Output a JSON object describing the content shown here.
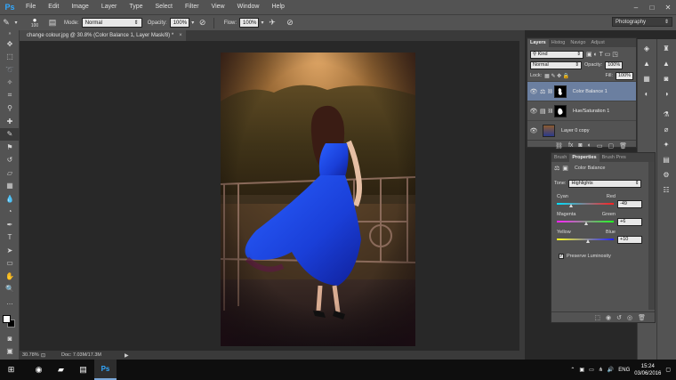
{
  "app": {
    "logo": "Ps"
  },
  "menu": [
    "File",
    "Edit",
    "Image",
    "Layer",
    "Type",
    "Select",
    "Filter",
    "View",
    "Window",
    "Help"
  ],
  "window_controls": {
    "minimize": "–",
    "maximize": "□",
    "close": "✕"
  },
  "options_bar": {
    "brush_size": "100",
    "mode_label": "Mode:",
    "mode_value": "Normal",
    "opacity_label": "Opacity:",
    "opacity_value": "100%",
    "flow_label": "Flow:",
    "flow_value": "100%"
  },
  "workspace": "Photography",
  "document": {
    "tab_title": "change colour.jpg @ 30.8% (Color Balance 1, Layer Mask/8) *",
    "tab_close": "×"
  },
  "status": {
    "zoom": "30.78%",
    "doc_info": "Doc: 7.03M/17.3M"
  },
  "layers_panel": {
    "tabs": [
      "Layers",
      "Histog",
      "Navigo",
      "Adjust"
    ],
    "kind_label": "Kind",
    "blend_mode": "Normal",
    "opacity_label": "Opacity:",
    "opacity_value": "100%",
    "lock_label": "Lock:",
    "fill_label": "Fill:",
    "fill_value": "100%",
    "layers": [
      {
        "name": "Color Balance 1"
      },
      {
        "name": "Hue/Saturation 1"
      },
      {
        "name": "Layer 0 copy"
      }
    ]
  },
  "properties_panel": {
    "tabs": [
      "Brush",
      "Properties",
      "Brush Pres"
    ],
    "title": "Color Balance",
    "tone_label": "Tone:",
    "tone_value": "Highlights",
    "sliders": [
      {
        "left": "Cyan",
        "right": "Red",
        "value": "-49",
        "fraction": 0.255
      },
      {
        "left": "Magenta",
        "right": "Green",
        "value": "+6",
        "fraction": 0.53
      },
      {
        "left": "Yellow",
        "right": "Blue",
        "value": "+10",
        "fraction": 0.55
      }
    ],
    "preserve_label": "Preserve Luminosity",
    "preserve_checked": "✓"
  },
  "taskbar": {
    "language": "ENG",
    "time": "15:24",
    "date": "03/06/2016"
  },
  "colors": {
    "accent": "#31a8ff",
    "panel": "#535353",
    "selected_layer": "#6b7fa0"
  }
}
